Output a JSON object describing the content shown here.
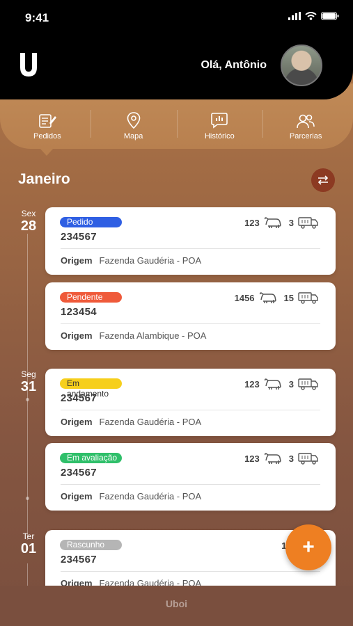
{
  "status_bar": {
    "time": "9:41"
  },
  "header": {
    "greeting": "Olá, Antônio"
  },
  "tabs": [
    {
      "label": "Pedidos",
      "icon": "orders-icon"
    },
    {
      "label": "Mapa",
      "icon": "map-pin-icon"
    },
    {
      "label": "Histórico",
      "icon": "history-chart-icon"
    },
    {
      "label": "Parcerias",
      "icon": "partners-icon"
    }
  ],
  "section": {
    "month": "Janeiro"
  },
  "days": [
    {
      "weekday": "Sex",
      "day": "28"
    },
    {
      "weekday": "Seg",
      "day": "31"
    },
    {
      "weekday": "Ter",
      "day": "01"
    }
  ],
  "cards": [
    {
      "status": "Pedido",
      "status_color": "#2f5fe3",
      "number": "234567",
      "cattle": "123",
      "trucks": "3",
      "origin_label": "Origem",
      "origin": "Fazenda Gaudéria - POA"
    },
    {
      "status": "Pendente",
      "status_color": "#ef5a3a",
      "number": "123454",
      "cattle": "1456",
      "trucks": "15",
      "origin_label": "Origem",
      "origin": "Fazenda Alambique - POA"
    },
    {
      "status": "Em andamento",
      "status_color": "#f6cf1c",
      "number": "234567",
      "cattle": "123",
      "trucks": "3",
      "origin_label": "Origem",
      "origin": "Fazenda Gaudéria - POA"
    },
    {
      "status": "Em avaliação",
      "status_color": "#2fbf6a",
      "number": "234567",
      "cattle": "123",
      "trucks": "3",
      "origin_label": "Origem",
      "origin": "Fazenda Gaudéria - POA"
    },
    {
      "status": "Rascunho",
      "status_color": "#b5b5b5",
      "number": "234567",
      "cattle": "123",
      "trucks": "",
      "origin_label": "Origem",
      "origin": "Fazenda Gaudéria - POA"
    }
  ],
  "fab": {
    "label": "+"
  },
  "footer": {
    "brand": "Uboi"
  }
}
